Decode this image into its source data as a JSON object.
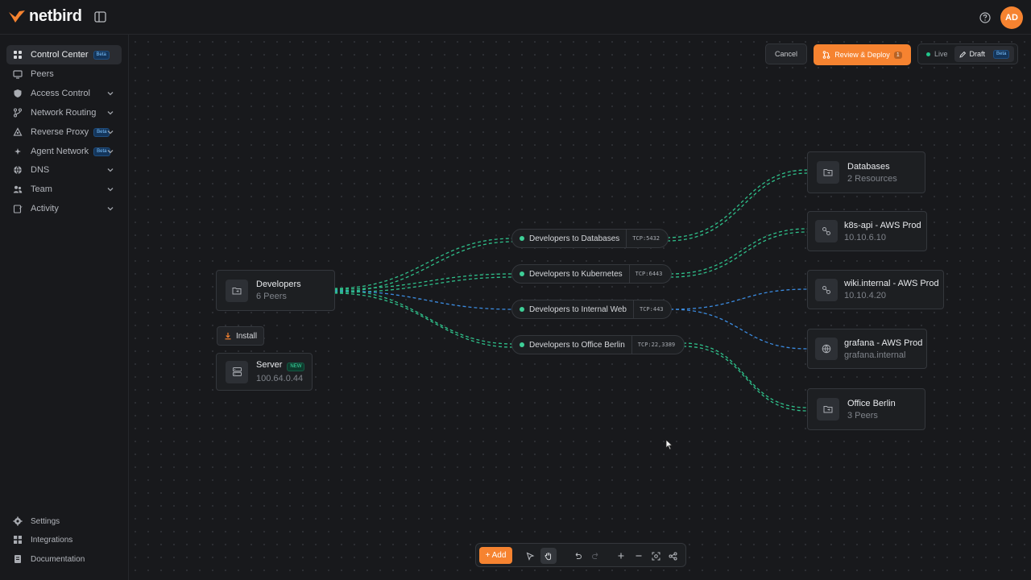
{
  "app": {
    "brand": "netbird",
    "brand_color": "#f68330",
    "avatar_initials": "AD"
  },
  "sidebar": {
    "items": [
      {
        "label": "Control Center",
        "badge": "Beta",
        "icon": "control-center-icon",
        "active": true
      },
      {
        "label": "Peers",
        "icon": "monitor-icon"
      },
      {
        "label": "Access Control",
        "icon": "shield-icon",
        "expandable": true
      },
      {
        "label": "Network Routing",
        "icon": "network-icon",
        "expandable": true
      },
      {
        "label": "Reverse Proxy",
        "badge": "Beta",
        "icon": "proxy-icon",
        "expandable": true
      },
      {
        "label": "Agent Network",
        "badge": "Beta",
        "icon": "sparkle-icon",
        "expandable": true
      },
      {
        "label": "DNS",
        "icon": "globe-icon",
        "expandable": true
      },
      {
        "label": "Team",
        "icon": "team-icon",
        "expandable": true
      },
      {
        "label": "Activity",
        "icon": "activity-icon",
        "expandable": true
      }
    ],
    "footer": [
      {
        "label": "Settings",
        "icon": "gear-icon"
      },
      {
        "label": "Integrations",
        "icon": "integrations-icon"
      },
      {
        "label": "Documentation",
        "icon": "document-icon"
      }
    ]
  },
  "actions": {
    "cancel": "Cancel",
    "deploy": "Review & Deploy",
    "deploy_count": "1"
  },
  "mode": {
    "live": "Live",
    "draft": "Draft",
    "draft_badge": "Beta"
  },
  "graph": {
    "source": {
      "title": "Developers",
      "subtitle": "6 Peers"
    },
    "install": "Install",
    "server": {
      "title": "Server",
      "badge": "NEW",
      "subtitle": "100.64.0.44"
    },
    "policies": [
      {
        "label": "Developers to Databases",
        "tag": "TCP:5432"
      },
      {
        "label": "Developers to Kubernetes",
        "tag": "TCP:6443"
      },
      {
        "label": "Developers to Internal Web",
        "tag": "TCP:443"
      },
      {
        "label": "Developers to Office Berlin",
        "tag": "TCP:22,3389"
      }
    ],
    "targets": [
      {
        "title": "Databases",
        "subtitle": "2 Resources",
        "icon": "folder-icon"
      },
      {
        "title": "k8s-api  -  AWS Prod",
        "subtitle": "10.10.6.10",
        "icon": "route-icon"
      },
      {
        "title": "wiki.internal  -  AWS Prod",
        "subtitle": "10.10.4.20",
        "icon": "route-icon"
      },
      {
        "title": "grafana  -  AWS Prod",
        "subtitle": "grafana.internal",
        "icon": "globe-icon"
      },
      {
        "title": "Office Berlin",
        "subtitle": "3 Peers",
        "icon": "folder-icon"
      }
    ],
    "edge_colors": {
      "green": "#2fbf8a",
      "blue": "#3b8be0"
    }
  },
  "toolbar": {
    "add": "+ Add"
  }
}
